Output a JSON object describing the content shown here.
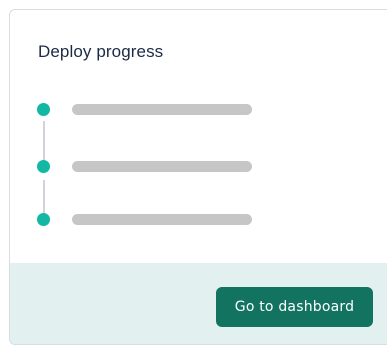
{
  "card": {
    "title": "Deploy progress"
  },
  "steps": [
    {
      "status": "complete"
    },
    {
      "status": "complete"
    },
    {
      "status": "complete"
    }
  ],
  "colors": {
    "dot": "#12b8a3",
    "placeholder_bar": "#c6c6c6",
    "button_bg": "#127360",
    "footer_bg": "#e2f1f0"
  },
  "footer": {
    "button_label": "Go to dashboard"
  }
}
